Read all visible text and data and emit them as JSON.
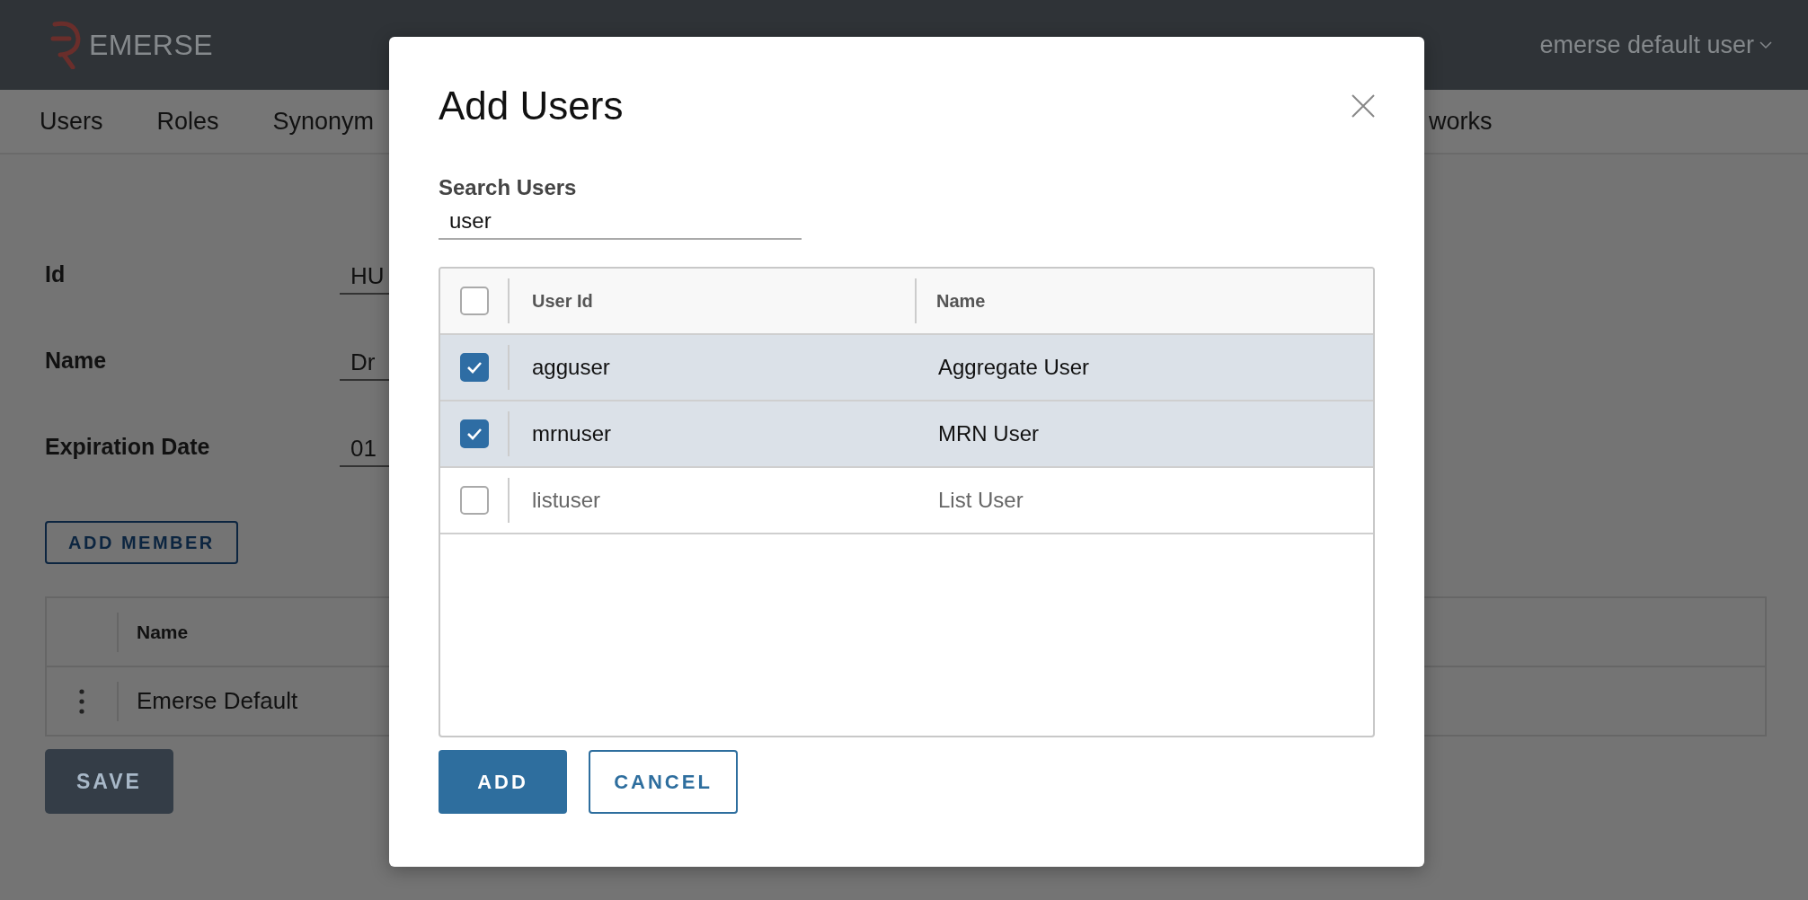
{
  "header": {
    "logo": "EMERSE",
    "user_menu": "emerse default user"
  },
  "nav": {
    "items": [
      {
        "label": "Users"
      },
      {
        "label": "Roles"
      },
      {
        "label": "Synonym"
      },
      {
        "label": "works"
      }
    ]
  },
  "form": {
    "fields": [
      {
        "label": "Id",
        "value": "HU"
      },
      {
        "label": "Name",
        "value": "Dr"
      },
      {
        "label": "Expiration Date",
        "value": "01"
      }
    ]
  },
  "add_member_button": "ADD MEMBER",
  "members_table": {
    "columns": [
      "Name"
    ],
    "rows": [
      {
        "name": "Emerse Default"
      }
    ]
  },
  "save_button": "SAVE",
  "dialog": {
    "title": "Add Users",
    "search": {
      "label": "Search Users",
      "value": "user"
    },
    "table": {
      "select_all_checked": false,
      "columns": [
        "User Id",
        "Name"
      ],
      "rows": [
        {
          "user_id": "agguser",
          "name": "Aggregate User",
          "checked": true
        },
        {
          "user_id": "mrnuser",
          "name": "MRN User",
          "checked": true
        },
        {
          "user_id": "listuser",
          "name": "List User",
          "checked": false
        }
      ]
    },
    "buttons": [
      {
        "label": "ADD",
        "kind": "primary"
      },
      {
        "label": "CANCEL",
        "kind": "secondary"
      }
    ]
  }
}
